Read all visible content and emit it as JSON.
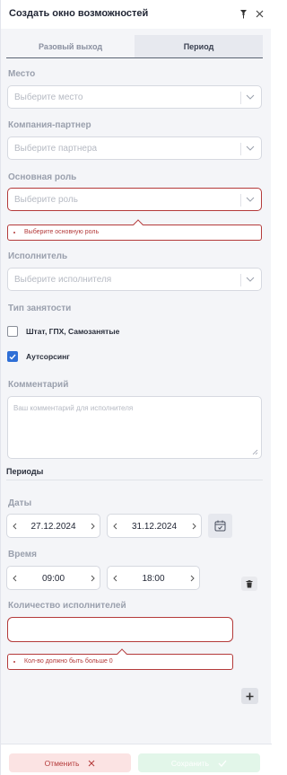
{
  "header": {
    "title": "Создать окно возможностей",
    "pin_icon": "pin-icon",
    "close_icon": "close-icon"
  },
  "tabs": [
    {
      "label": "Разовый выход",
      "active": false
    },
    {
      "label": "Период",
      "active": true
    }
  ],
  "fields": {
    "location": {
      "label": "Место",
      "placeholder": "Выберите место"
    },
    "partner": {
      "label": "Компания-партнер",
      "placeholder": "Выберите партнера"
    },
    "role": {
      "label": "Основная роль",
      "placeholder": "Выберите роль",
      "error": "Выберите основную роль"
    },
    "performer": {
      "label": "Исполнитель",
      "placeholder": "Выберите исполнителя"
    }
  },
  "employment": {
    "label": "Тип занятости",
    "options": [
      {
        "label": "Штат, ГПХ, Самозанятые",
        "checked": false
      },
      {
        "label": "Аутсорсинг",
        "checked": true
      }
    ]
  },
  "comment": {
    "label": "Комментарий",
    "placeholder": "Ваш комментарий для исполнителя"
  },
  "periods": {
    "title": "Периоды",
    "dates_label": "Даты",
    "date_from": "27.12.2024",
    "date_to": "31.12.2024",
    "time_label": "Время",
    "time_from": "09:00",
    "time_to": "18:00",
    "count_label": "Количество исполнителей",
    "count_value": "",
    "count_error": "Кол-во должно быть больше 0"
  },
  "footer": {
    "cancel_label": "Отменить",
    "save_label": "Сохранить"
  },
  "colors": {
    "error": "#b43a3a",
    "accent": "#2f6fd6",
    "save_bg": "#e2f6e9",
    "cancel_bg": "#fbe3e3"
  }
}
